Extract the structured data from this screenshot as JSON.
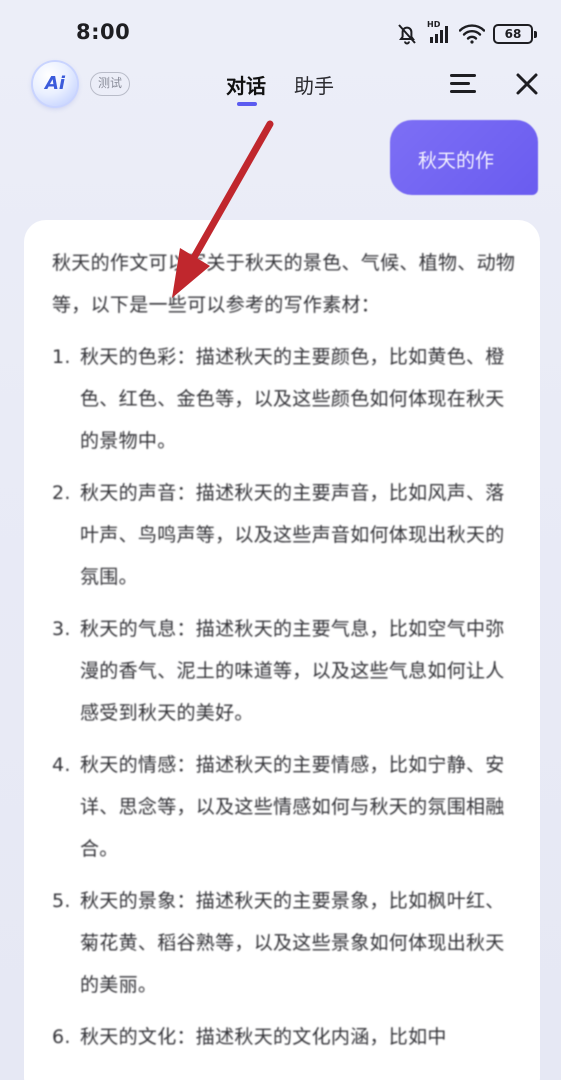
{
  "status_bar": {
    "time": "8:00",
    "hd_label": "HD",
    "battery": "68",
    "icons": [
      "mute-bell-icon",
      "signal-icon",
      "wifi-icon",
      "battery-icon"
    ]
  },
  "header": {
    "logo_text": "Ai",
    "badge": "测试",
    "tabs": [
      {
        "label": "对话",
        "active": true
      },
      {
        "label": "助手",
        "active": false
      }
    ],
    "icons": [
      "menu-icon",
      "close-icon"
    ],
    "accent_color": "#5b5bf0"
  },
  "user_message": {
    "text": "秋天的作"
  },
  "answer": {
    "intro": "秋天的作文可以写关于秋天的景色、气候、植物、动物等，以下是一些可以参考的写作素材：",
    "items": [
      {
        "num": "1.",
        "text": "秋天的色彩：描述秋天的主要颜色，比如黄色、橙色、红色、金色等，以及这些颜色如何体现在秋天的景物中。"
      },
      {
        "num": "2.",
        "text": "秋天的声音：描述秋天的主要声音，比如风声、落叶声、鸟鸣声等，以及这些声音如何体现出秋天的氛围。"
      },
      {
        "num": "3.",
        "text": "秋天的气息：描述秋天的主要气息，比如空气中弥漫的香气、泥土的味道等，以及这些气息如何让人感受到秋天的美好。"
      },
      {
        "num": "4.",
        "text": "秋天的情感：描述秋天的主要情感，比如宁静、安详、思念等，以及这些情感如何与秋天的氛围相融合。"
      },
      {
        "num": "5.",
        "text": "秋天的景象：描述秋天的主要景象，比如枫叶红、菊花黄、稻谷熟等，以及这些景象如何体现出秋天的美丽。"
      },
      {
        "num": "6.",
        "text": "秋天的文化：描述秋天的文化内涵，比如中"
      }
    ]
  },
  "annotation": {
    "arrow_color": "#c0272d"
  }
}
